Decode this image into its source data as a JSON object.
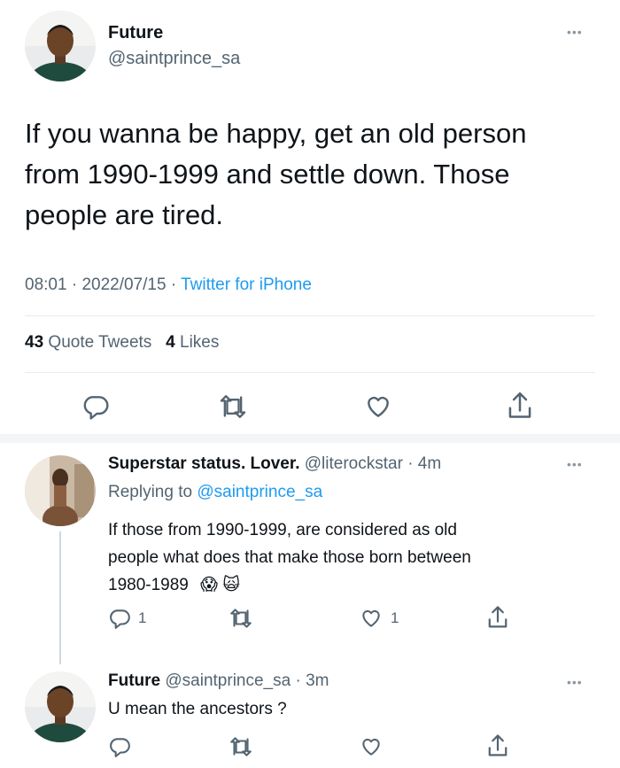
{
  "main_tweet": {
    "display_name": "Future",
    "handle": "@saintprince_sa",
    "text_lines": [
      "If you wanna be happy, get an old person",
      "from 1990-1999 and settle down. Those",
      "people are tired."
    ],
    "time": "08:01",
    "date": "2022/07/15",
    "source": "Twitter for iPhone",
    "quote_tweets_count": "43",
    "quote_tweets_label": "Quote Tweets",
    "likes_count": "4",
    "likes_label": "Likes"
  },
  "reply_1": {
    "display_name": "Superstar status. Lover.",
    "handle": "@literockstar",
    "time_ago": "4m",
    "replying_to_label": "Replying to",
    "replying_to_handle": "@saintprince_sa",
    "text_lines": [
      "If those from 1990-1999, are considered as old",
      "people what does that make those born between",
      "1980-1989"
    ],
    "emojis": [
      "😱",
      "🙀"
    ],
    "reply_count": "1",
    "like_count": "1"
  },
  "reply_2": {
    "display_name": "Future",
    "handle": "@saintprince_sa",
    "time_ago": "3m",
    "text": "U mean the ancestors ?"
  },
  "separator": "·",
  "more_glyph": "•••",
  "colors": {
    "accent": "#1d9bf0",
    "secondary_text": "#536471",
    "divider": "#e6ecf0"
  },
  "icons": [
    "reply-icon",
    "retweet-icon",
    "like-icon",
    "share-icon",
    "more-icon"
  ]
}
